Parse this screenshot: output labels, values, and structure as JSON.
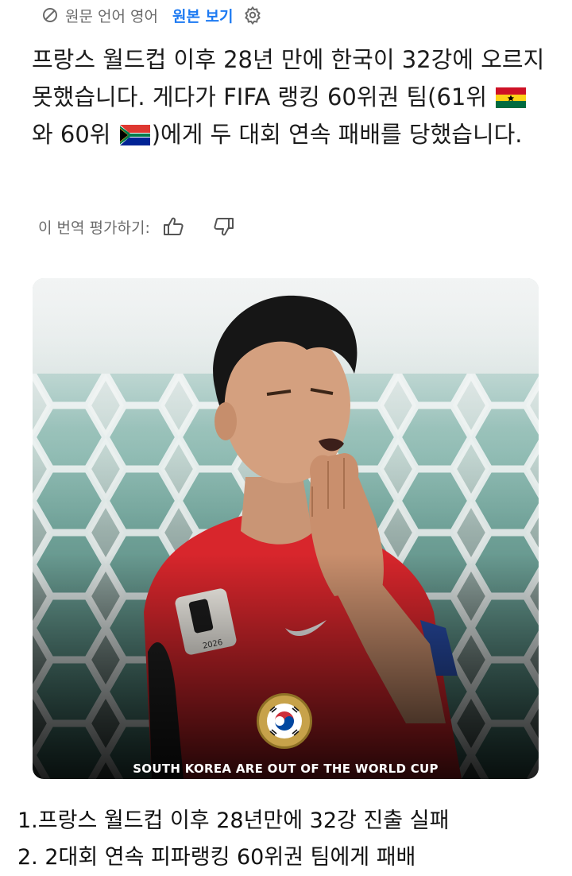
{
  "translate_bar": {
    "lang_label": "원문 언어 영어",
    "view_original": "원본 보기"
  },
  "post": {
    "text_1": "프랑스 월드컵 이후 28년 만에 한국이 32강에 오르지 못했습니다. 게다가 FIFA 랭킹 60위권 팀(61위 ",
    "text_2": "와 60위 ",
    "text_3": ")에게 두 대회 연속 패배를 당했습니다."
  },
  "rating": {
    "label": "이 번역 평가하기:"
  },
  "image": {
    "headline": "SOUTH KOREA ARE OUT OF THE WORLD CUP",
    "patch_year": "2026"
  },
  "summary": {
    "line_1": "1.프랑스 월드컵 이후 28년만에 32강 진출 실패",
    "line_2": "2. 2대회 연속 피파랭킹 60위권 팀에게 패배"
  },
  "colors": {
    "link": "#1d7af2",
    "muted": "#6b6b6b",
    "jersey": "#e1252b"
  }
}
